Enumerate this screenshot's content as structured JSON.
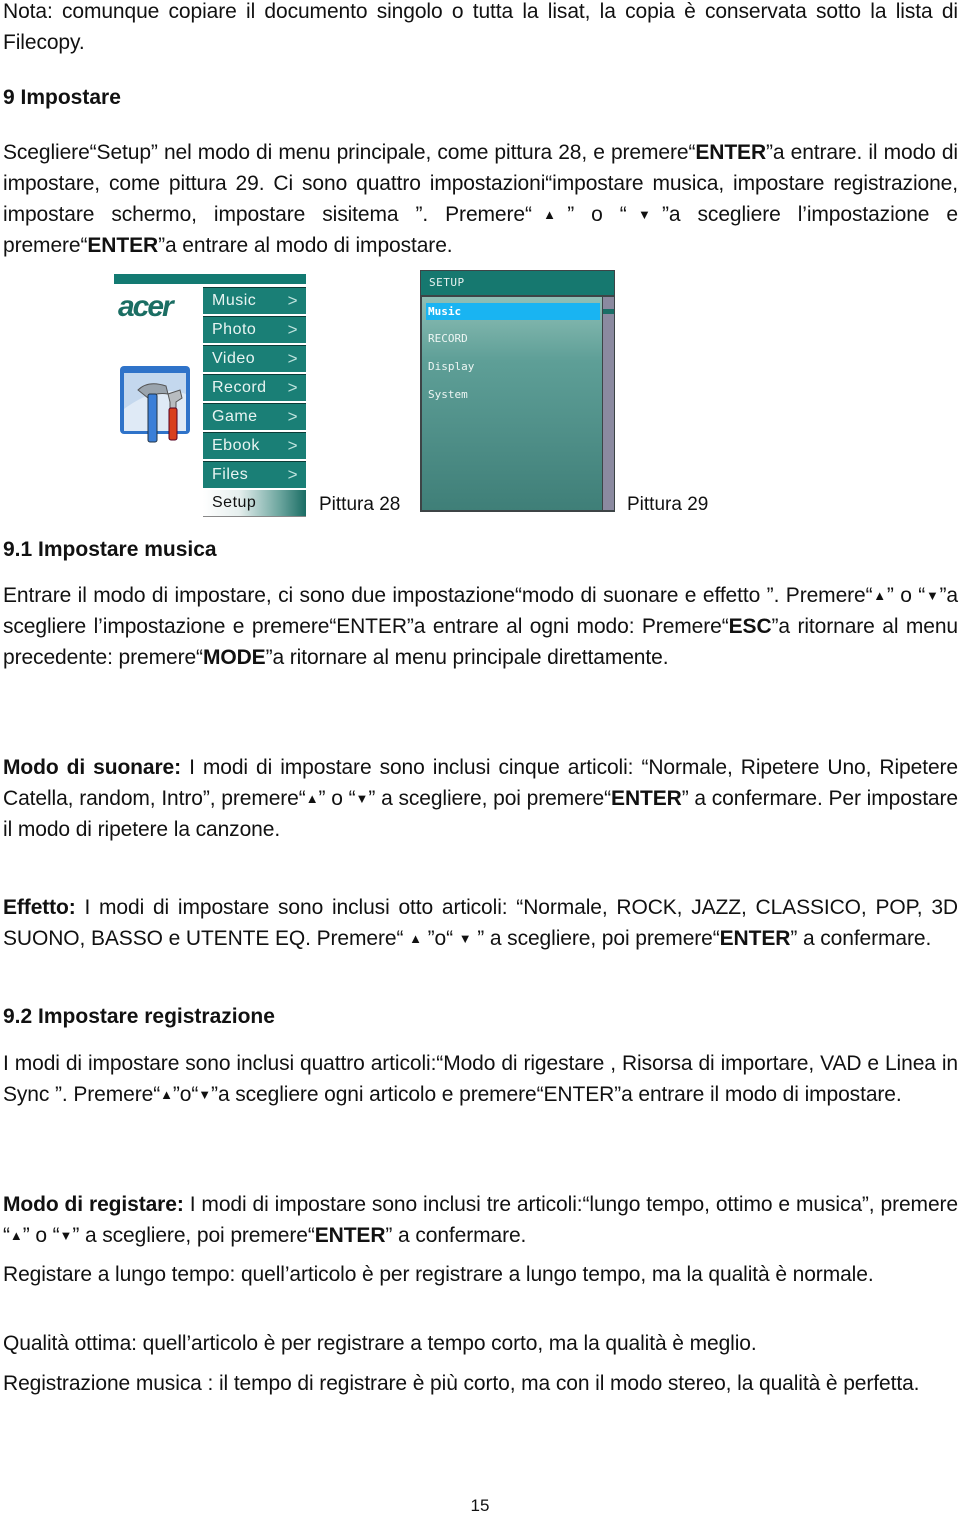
{
  "note": {
    "text": "Nota: comunque copiare il documento singolo o tutta la lisat, la copia è conservata sotto la lista di Filecopy."
  },
  "section9": {
    "heading": "9  Impostare",
    "p1_parts": [
      "Scegliere“Setup” nel modo di menu principale, come pittura 28, e premere“",
      "ENTER",
      "”a entrare. il modo di impostare, come pittura 29. Ci sono quattro impostazioni“impostare musica, impostare registrazione, impostare schermo, impostare sisitema ”. Premere“",
      "▲",
      "” o “",
      "▼",
      "”a scegliere l’impostazione e premere“",
      "ENTER",
      "”a entrare al modo di impostare."
    ]
  },
  "figure28": {
    "logo": "acer",
    "icon": "tools-icon",
    "menu_items": [
      {
        "label": "Music",
        "chevron": ">"
      },
      {
        "label": "Photo",
        "chevron": ">"
      },
      {
        "label": "Video",
        "chevron": ">"
      },
      {
        "label": "Record",
        "chevron": ">"
      },
      {
        "label": "Game",
        "chevron": ">"
      },
      {
        "label": "Ebook",
        "chevron": ">"
      },
      {
        "label": "Files",
        "chevron": ">"
      },
      {
        "label": "Setup",
        "chevron": ""
      }
    ],
    "selected": "Setup",
    "caption": "Pittura 28"
  },
  "figure29": {
    "title": "SETUP",
    "items": [
      "Music",
      "RECORD",
      "Display",
      "System"
    ],
    "selected": "Music",
    "caption": "Pittura 29",
    "colors": {
      "titlebar": "#16786f",
      "highlight": "#19b4f2",
      "scrollbar": "#8b8aa0"
    }
  },
  "section9_1": {
    "heading": "9.1 Impostare musica",
    "p1_parts": [
      "Entrare il modo di impostare, ci sono due impostazione“modo di suonare e effetto ”. Premere“",
      "▲",
      "” o “",
      "▼",
      "”a scegliere l’impostazione e premere“ENTER”a entrare al ogni modo: Premere“",
      "ESC",
      "”a ritornare al menu precedente: premere“",
      "MODE",
      "”a ritornare al menu principale direttamente."
    ],
    "play_mode": {
      "label": "Modo di suonare:",
      "parts": [
        " I modi di impostare sono inclusi cinque articoli: “Normale, Ripetere Uno, Ripetere Catella, random, Intro”, premere“",
        "▲",
        "” o “",
        "▼",
        "” a scegliere, poi premere“",
        "ENTER",
        "” a confermare. Per impostare il modo di ripetere la canzone."
      ]
    },
    "effect": {
      "label": "Effetto:",
      "parts": [
        " I modi di impostare sono inclusi otto articoli: “Normale, ROCK, JAZZ, CLASSICO, POP, 3D SUONO, BASSO e UTENTE EQ. Premere“ ",
        "▲",
        " ”o“ ",
        "▼",
        " ” a scegliere, poi premere“",
        "ENTER",
        "” a confermare."
      ]
    }
  },
  "section9_2": {
    "heading": "9.2 Impostare registrazione",
    "p1_parts": [
      "I modi di impostare sono inclusi quattro articoli:“Modo di rigestare , Risorsa di importare, VAD e Linea in Sync ”. Premere“",
      "▲",
      "”o“",
      "▼",
      "”a scegliere ogni articolo e premere“ENTER”a entrare il modo di impostare."
    ],
    "rec_mode": {
      "label": "Modo di registare:",
      "parts": [
        " I modi di impostare sono inclusi tre articoli:“lungo tempo, ottimo e musica”, premere “",
        "▲",
        "” o “",
        "▼",
        "” a scegliere, poi premere“",
        "ENTER",
        "” a confermare."
      ]
    },
    "long_time": "Registare a lungo tempo: quell’articolo è per registrare a lungo tempo, ma la qualità è normale.",
    "best_quality": "Qualità ottima: quell’articolo è per registrare a tempo corto, ma la qualità è meglio.",
    "music_rec": "Registrazione musica : il tempo di registrare è più corto, ma con il modo stereo, la qualità è perfetta."
  },
  "page_number": "15"
}
